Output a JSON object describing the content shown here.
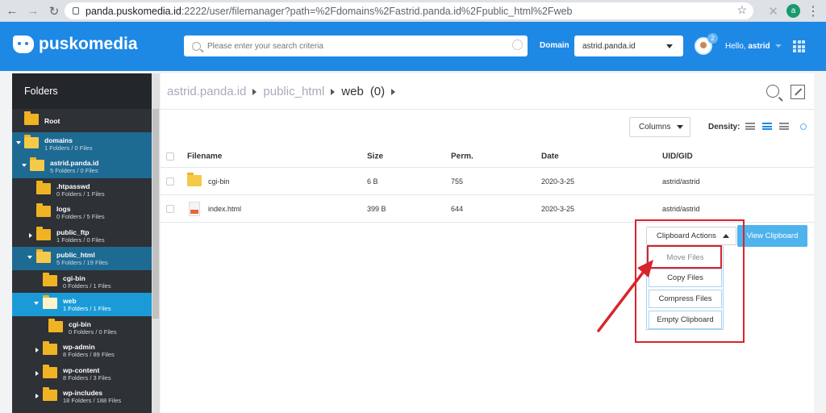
{
  "browser": {
    "url_host": "panda.puskomedia.id",
    "url_rest": ":2222/user/filemanager?path=%2Fdomains%2Fastrid.panda.id%2Fpublic_html%2Fweb",
    "profile_initial": "a"
  },
  "header": {
    "brand": "puskomedia",
    "search_placeholder": "Please enter your search criteria",
    "domain_label": "Domain",
    "domain_value": "astrid.panda.id",
    "notification_count": "2",
    "hello_prefix": "Hello,",
    "hello_user": "astrid"
  },
  "sidebar": {
    "title": "Folders",
    "items": [
      {
        "name": "Root",
        "info": ""
      },
      {
        "name": "domains",
        "info": "1 Folders / 0 Files"
      },
      {
        "name": "astrid.panda.id",
        "info": "5 Folders / 0 Files"
      },
      {
        "name": ".htpasswd",
        "info": "0 Folders / 1 Files"
      },
      {
        "name": "logs",
        "info": "0 Folders / 5 Files"
      },
      {
        "name": "public_ftp",
        "info": "1 Folders / 0 Files"
      },
      {
        "name": "public_html",
        "info": "5 Folders / 19 Files"
      },
      {
        "name": "cgi-bin",
        "info": "0 Folders / 1 Files"
      },
      {
        "name": "web",
        "info": "1 Folders / 1 Files"
      },
      {
        "name": "cgi-bin",
        "info": "0 Folders / 0 Files"
      },
      {
        "name": "wp-admin",
        "info": "8 Folders / 89 Files"
      },
      {
        "name": "wp-content",
        "info": "8 Folders / 3 Files"
      },
      {
        "name": "wp-includes",
        "info": "18 Folders / 188 Files"
      }
    ]
  },
  "breadcrumb": {
    "items": [
      "astrid.panda.id",
      "public_html"
    ],
    "current": "web",
    "count": "(0)"
  },
  "toolbar": {
    "columns_label": "Columns",
    "density_label": "Density:"
  },
  "table": {
    "headers": [
      "Filename",
      "Size",
      "Perm.",
      "Date",
      "UID/GID"
    ],
    "rows": [
      {
        "filename": "cgi-bin",
        "size": "6 B",
        "perm": "755",
        "date": "2020-3-25",
        "uid": "astrid/astrid",
        "kind": "folder"
      },
      {
        "filename": "index.html",
        "size": "399 B",
        "perm": "644",
        "date": "2020-3-25",
        "uid": "astrid/astrid",
        "kind": "html"
      }
    ]
  },
  "clipboard": {
    "actions_label": "Clipboard Actions",
    "view_label": "View Clipboard",
    "menu": [
      "Move Files",
      "Copy Files",
      "Compress Files",
      "Empty Clipboard"
    ]
  },
  "colors": {
    "brand_blue": "#1e88e5",
    "highlight_red": "#d9242b",
    "active_folder": "#1a9bd7"
  }
}
